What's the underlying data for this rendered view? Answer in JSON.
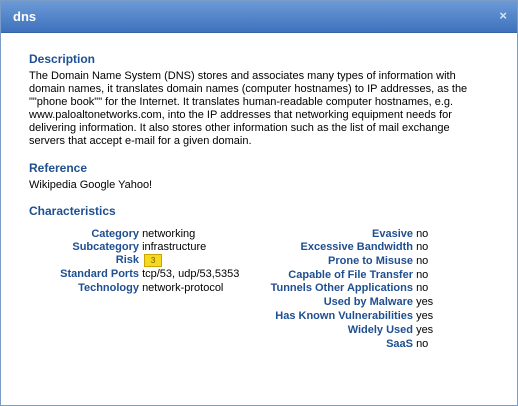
{
  "dialog": {
    "title": "dns",
    "close_glyph": "×"
  },
  "description": {
    "heading": "Description",
    "text": "The Domain Name System (DNS) stores and associates many types of information with domain names, it translates domain names (computer hostnames) to IP addresses, as the \"\"phone book\"\" for the Internet. It translates human-readable computer hostnames, e.g. www.paloaltonetworks.com, into the IP addresses that networking equipment needs for delivering information. It also stores other information such as the list of mail exchange servers that accept e-mail for a given domain."
  },
  "reference": {
    "heading": "Reference",
    "text": "Wikipedia Google Yahoo!"
  },
  "characteristics": {
    "heading": "Characteristics",
    "left": [
      {
        "label": "Category",
        "value": "networking"
      },
      {
        "label": "Subcategory",
        "value": "infrastructure"
      },
      {
        "label": "Risk",
        "value": "3"
      },
      {
        "label": "Standard Ports",
        "value": "tcp/53, udp/53,5353"
      },
      {
        "label": "Technology",
        "value": "network-protocol"
      }
    ],
    "right": [
      {
        "label": "Evasive",
        "value": "no"
      },
      {
        "label": "Excessive Bandwidth",
        "value": "no"
      },
      {
        "label": "Prone to Misuse",
        "value": "no"
      },
      {
        "label": "Capable of File Transfer",
        "value": "no"
      },
      {
        "label": "Tunnels Other Applications",
        "value": "no"
      },
      {
        "label": "Used by Malware",
        "value": "yes"
      },
      {
        "label": "Has Known Vulnerabilities",
        "value": "yes"
      },
      {
        "label": "Widely Used",
        "value": "yes"
      },
      {
        "label": "SaaS",
        "value": "no"
      }
    ]
  },
  "colors": {
    "titlebar": "#3f72bd",
    "heading": "#1f4f91",
    "risk_badge": "#f5d820"
  }
}
